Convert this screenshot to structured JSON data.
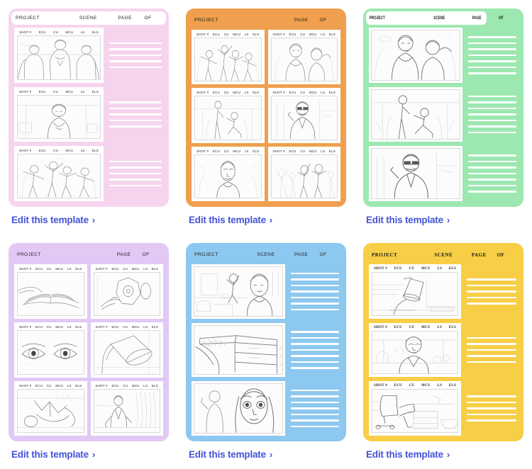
{
  "page": {
    "link_label": "Edit this template",
    "chevron": "›"
  },
  "shot_labels": [
    "SHOT #",
    "ECU",
    "CU",
    "MCU",
    "LS",
    "ELS"
  ],
  "header_fields": {
    "project": "PROJECT",
    "scene": "SCENE",
    "page": "PAGE",
    "of": "OF"
  },
  "colors": {
    "pink": "#F6D4EE",
    "orange": "#EF9F4D",
    "green": "#9CE8B0",
    "lavender": "#E2C9F5",
    "blue": "#8DC8F0",
    "yellow": "#F7CE46",
    "link": "#4353D8",
    "panel": "#FFFFFF",
    "line": "#FFFFFF"
  },
  "templates": [
    {
      "id": "pink-3panel",
      "color": "#F6D4EE",
      "header_style": "white-bar",
      "header": [
        "PROJECT",
        "SCENE",
        "PAGE",
        "OF"
      ],
      "layout": "3-rows-with-lines",
      "panels": [
        {
          "shot_labels": [
            "SHOT #",
            "ECU",
            "CU",
            "MCU",
            "LS",
            "ELS"
          ],
          "sketch": "three-women-group",
          "lines": 5
        },
        {
          "shot_labels": [
            "SHOT #",
            "ECU",
            "CU",
            "MCU",
            "LS",
            "ELS"
          ],
          "sketch": "woman-indoors-mid",
          "lines": 5
        },
        {
          "shot_labels": [
            "SHOT #",
            "ECU",
            "CU",
            "MCU",
            "LS",
            "ELS"
          ],
          "sketch": "dancing-crowd",
          "lines": 5
        }
      ],
      "link_label": "Edit this template"
    },
    {
      "id": "orange-6panel",
      "color": "#EF9F4D",
      "header_style": "plain",
      "header": [
        "PROJECT",
        "PAGE",
        "OF"
      ],
      "layout": "2x3-grid",
      "panels": [
        {
          "shot_labels": [
            "SHOT #",
            "ECU",
            "CU",
            "MCU",
            "LS",
            "ELS"
          ],
          "sketch": "dancing-crowd"
        },
        {
          "shot_labels": [
            "SHOT #",
            "ECU",
            "CU",
            "MCU",
            "LS",
            "ELS"
          ],
          "sketch": "couple-portrait"
        },
        {
          "shot_labels": [
            "SHOT #",
            "ECU",
            "CU",
            "MCU",
            "LS",
            "ELS"
          ],
          "sketch": "proposal-kneeling"
        },
        {
          "shot_labels": [
            "SHOT #",
            "ECU",
            "CU",
            "MCU",
            "LS",
            "ELS"
          ],
          "sketch": "man-sunglasses"
        },
        {
          "shot_labels": [
            "SHOT #",
            "ECU",
            "CU",
            "MCU",
            "LS",
            "ELS"
          ],
          "sketch": "woman-closeup"
        },
        {
          "shot_labels": [
            "SHOT #",
            "ECU",
            "CU",
            "MCU",
            "LS",
            "ELS"
          ],
          "sketch": "cheering-crowd"
        }
      ],
      "link_label": "Edit this template"
    },
    {
      "id": "green-3panel",
      "color": "#9CE8B0",
      "header_style": "condensed-bold",
      "header": [
        "PROJECT",
        "SCENE",
        "PAGE",
        "OF"
      ],
      "layout": "3-rows-with-lines",
      "panels": [
        {
          "shot_labels": [],
          "sketch": "couple-portrait",
          "lines": 7
        },
        {
          "shot_labels": [],
          "sketch": "proposal-kneeling",
          "lines": 7
        },
        {
          "shot_labels": [],
          "sketch": "man-sunglasses",
          "lines": 7
        }
      ],
      "link_label": "Edit this template"
    },
    {
      "id": "lavender-6panel",
      "color": "#E2C9F5",
      "header_style": "plain",
      "header": [
        "PROJECT",
        "PAGE",
        "OF"
      ],
      "layout": "2x3-grid",
      "panels": [
        {
          "shot_labels": [
            "SHOT #",
            "ECU",
            "CU",
            "MCU",
            "LS",
            "ELS"
          ],
          "sketch": "open-book"
        },
        {
          "shot_labels": [
            "SHOT #",
            "ECU",
            "CU",
            "MCU",
            "LS",
            "ELS"
          ],
          "sketch": "alarm-clock-hand"
        },
        {
          "shot_labels": [
            "SHOT #",
            "ECU",
            "CU",
            "MCU",
            "LS",
            "ELS"
          ],
          "sketch": "pair-of-eyes"
        },
        {
          "shot_labels": [
            "SHOT #",
            "ECU",
            "CU",
            "MCU",
            "LS",
            "ELS"
          ],
          "sketch": "desk-lamp-ecu"
        },
        {
          "shot_labels": [
            "SHOT #",
            "ECU",
            "CU",
            "MCU",
            "LS",
            "ELS"
          ],
          "sketch": "person-reclining"
        },
        {
          "shot_labels": [
            "SHOT #",
            "ECU",
            "CU",
            "MCU",
            "LS",
            "ELS"
          ],
          "sketch": "man-seated-rain"
        }
      ],
      "link_label": "Edit this template"
    },
    {
      "id": "blue-3panel",
      "color": "#8DC8F0",
      "header_style": "plain",
      "header": [
        "PROJECT",
        "SCENE",
        "PAGE",
        "OF"
      ],
      "layout": "3-rows-with-lines",
      "panels": [
        {
          "shot_labels": [],
          "sketch": "kitchen-argument",
          "lines": 7
        },
        {
          "shot_labels": [],
          "sketch": "desk-drawer",
          "lines": 7
        },
        {
          "shot_labels": [],
          "sketch": "woman-face-shock",
          "lines": 7
        }
      ],
      "link_label": "Edit this template"
    },
    {
      "id": "yellow-3panel",
      "color": "#F7CE46",
      "header_style": "serif-bold",
      "header": [
        "PROJECT",
        "SCENE",
        "PAGE",
        "OF"
      ],
      "layout": "3-rows-with-lines",
      "panels": [
        {
          "shot_labels": [
            "SHOT #",
            "ECU",
            "CU",
            "MCU",
            "LS",
            "ELS"
          ],
          "sketch": "desk-lamp-wide",
          "lines": 5
        },
        {
          "shot_labels": [
            "SHOT #",
            "ECU",
            "CU",
            "MCU",
            "LS",
            "ELS"
          ],
          "sketch": "woman-at-desk",
          "lines": 5
        },
        {
          "shot_labels": [
            "SHOT #",
            "ECU",
            "CU",
            "MCU",
            "LS",
            "ELS"
          ],
          "sketch": "office-chair-desk",
          "lines": 5
        }
      ],
      "link_label": "Edit this template"
    }
  ]
}
